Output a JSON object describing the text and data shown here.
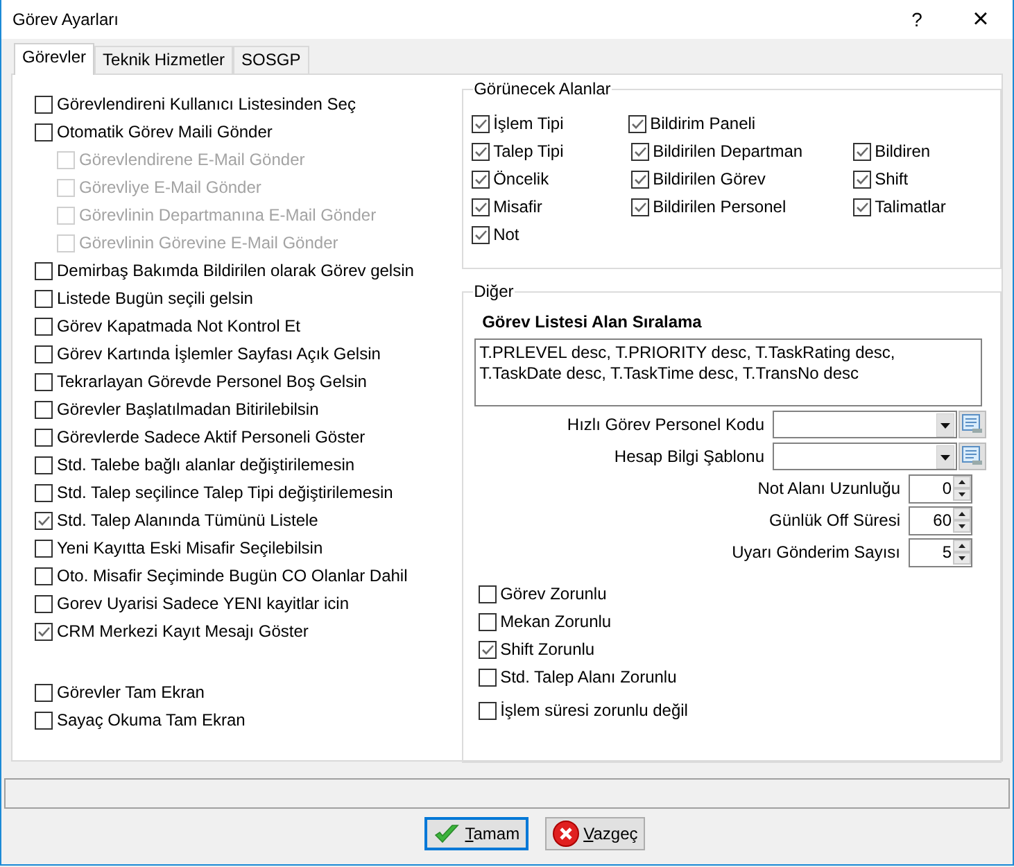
{
  "window": {
    "title": "Görev Ayarları",
    "help": "?",
    "close": "×"
  },
  "tabs": [
    {
      "label": "Görevler",
      "selected": true
    },
    {
      "label": "Teknik Hizmetler",
      "selected": false
    },
    {
      "label": "SOSGP",
      "selected": false
    }
  ],
  "options": [
    {
      "label": "Görevlendireni Kullanıcı Listesinden Seç",
      "checked": false,
      "disabled": false
    },
    {
      "label": "Otomatik Görev Maili Gönder",
      "checked": false,
      "disabled": false,
      "children": [
        {
          "label": "Görevlendirene E-Mail Gönder",
          "checked": false,
          "disabled": true
        },
        {
          "label": "Görevliye E-Mail Gönder",
          "checked": false,
          "disabled": true
        },
        {
          "label": "Görevlinin Departmanına E-Mail Gönder",
          "checked": false,
          "disabled": true
        },
        {
          "label": "Görevlinin Görevine E-Mail Gönder",
          "checked": false,
          "disabled": true
        }
      ]
    },
    {
      "label": "Demirbaş Bakımda Bildirilen olarak Görev gelsin",
      "checked": false,
      "disabled": false
    },
    {
      "label": "Listede Bugün seçili gelsin",
      "checked": false,
      "disabled": false
    },
    {
      "label": "Görev Kapatmada Not Kontrol Et",
      "checked": false,
      "disabled": false
    },
    {
      "label": "Görev Kartında İşlemler Sayfası Açık Gelsin",
      "checked": false,
      "disabled": false
    },
    {
      "label": "Tekrarlayan Görevde Personel Boş Gelsin",
      "checked": false,
      "disabled": false
    },
    {
      "label": "Görevler Başlatılmadan Bitirilebilsin",
      "checked": false,
      "disabled": false
    },
    {
      "label": "Görevlerde Sadece Aktif Personeli Göster",
      "checked": false,
      "disabled": false
    },
    {
      "label": "Std. Talebe bağlı alanlar değiştirilemesin",
      "checked": false,
      "disabled": false
    },
    {
      "label": "Std. Talep seçilince Talep Tipi değiştirilemesin",
      "checked": false,
      "disabled": false
    },
    {
      "label": "Std. Talep Alanında Tümünü Listele",
      "checked": true,
      "disabled": false
    },
    {
      "label": "Yeni Kayıtta Eski Misafir Seçilebilsin",
      "checked": false,
      "disabled": false
    },
    {
      "label": "Oto. Misafir Seçiminde Bugün CO Olanlar Dahil",
      "checked": false,
      "disabled": false
    },
    {
      "label": "Gorev Uyarisi Sadece YENI kayitlar icin",
      "checked": false,
      "disabled": false
    },
    {
      "label": "CRM Merkezi Kayıt Mesajı Göster",
      "checked": true,
      "disabled": false
    }
  ],
  "screen_options": [
    {
      "label": "Görevler Tam Ekran",
      "checked": false,
      "disabled": false
    },
    {
      "label": "Sayaç Okuma Tam Ekran",
      "checked": false,
      "disabled": false
    }
  ],
  "visible_fields": {
    "title": "Görünecek Alanlar",
    "rows": [
      [
        {
          "label": "İşlem Tipi",
          "checked": true
        },
        {
          "label": "Bildirim Paneli",
          "checked": true
        }
      ],
      [
        {
          "label": "Talep Tipi",
          "checked": true
        },
        {
          "label": "Bildirilen Departman",
          "checked": true
        },
        {
          "label": "Bildiren",
          "checked": true
        }
      ],
      [
        {
          "label": "Öncelik",
          "checked": true
        },
        {
          "label": "Bildirilen Görev",
          "checked": true
        },
        {
          "label": "Shift",
          "checked": true
        }
      ],
      [
        {
          "label": "Misafir",
          "checked": true
        },
        {
          "label": "Bildirilen Personel",
          "checked": true
        },
        {
          "label": "Talimatlar",
          "checked": true
        }
      ],
      [
        {
          "label": "Not",
          "checked": true
        }
      ]
    ]
  },
  "other": {
    "title": "Diğer",
    "sort_label": "Görev Listesi Alan Sıralama",
    "sort_value": "T.PRLEVEL desc, T.PRIORITY desc, T.TaskRating desc, T.TaskDate desc, T.TaskTime desc, T.TransNo desc",
    "combos": [
      {
        "label": "Hızlı Görev Personel Kodu"
      },
      {
        "label": "Hesap Bilgi Şablonu"
      }
    ],
    "spinners": [
      {
        "label": "Not Alanı Uzunluğu",
        "value": "0"
      },
      {
        "label": "Günlük Off Süresi",
        "value": "60"
      },
      {
        "label": "Uyarı Gönderim Sayısı",
        "value": "5"
      }
    ],
    "required_options": [
      {
        "label": "Görev Zorunlu",
        "checked": false
      },
      {
        "label": "Mekan Zorunlu",
        "checked": false
      },
      {
        "label": "Shift Zorunlu",
        "checked": true
      },
      {
        "label": "Std. Talep Alanı Zorunlu",
        "checked": false
      }
    ],
    "duration_option": {
      "label": "İşlem süresi zorunlu değil",
      "checked": false
    }
  },
  "buttons": [
    {
      "label": "Tamam",
      "kind": "ok",
      "focused": true
    },
    {
      "label": "Vazgeç",
      "kind": "cancel",
      "focused": false
    }
  ]
}
